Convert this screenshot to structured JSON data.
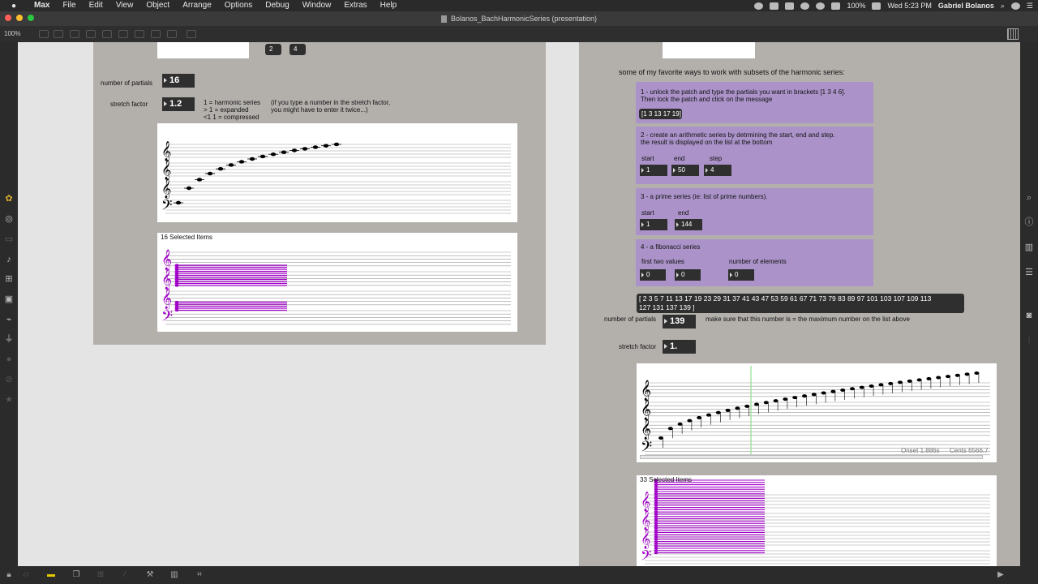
{
  "menubar": {
    "app": "Max",
    "items": [
      "File",
      "Edit",
      "View",
      "Object",
      "Arrange",
      "Options",
      "Debug",
      "Window",
      "Extras",
      "Help"
    ],
    "battery": "100%",
    "clock": "Wed 5:23 PM",
    "user": "Gabriel Bolanos"
  },
  "window": {
    "title": "Bolanos_BachHarmonicSeries (presentation)"
  },
  "toolbar": {
    "zoom": "100%"
  },
  "left_patch": {
    "small_boxes": [
      "2",
      "4"
    ],
    "partials_label": "number of partials",
    "partials_value": "16",
    "stretch_label": "stretch factor",
    "stretch_value": "1.2",
    "legend": [
      "1 = harmonic series",
      "> 1 = expanded",
      "<1 1 = compressed"
    ],
    "note": [
      "(if you type a number in the stretch factor,",
      "you might have to enter it twice...)"
    ],
    "selected_label": "16 Selected Items"
  },
  "right_patch": {
    "heading": "some of my favorite ways to work with subsets of the harmonic series:",
    "section1": {
      "text": [
        "1 - unlock the patch and type the partials you want in brackets [1 3 4 6].",
        "Then lock the patch and click on the message"
      ],
      "message": "[1 3 13 17 19]"
    },
    "section2": {
      "text": [
        "2 - create an arithmetic series by detrmining the start, end and step.",
        "the result is displayed on the list at the bottom"
      ],
      "labels": [
        "start",
        "end",
        "step"
      ],
      "values": [
        "1",
        "50",
        "4"
      ]
    },
    "section3": {
      "text": "3 - a prime series (ie: list of prime numbers).",
      "labels": [
        "start",
        "end"
      ],
      "values": [
        "1",
        "144"
      ]
    },
    "section4": {
      "text": "4 - a fibonacci series",
      "labels": [
        "first two values",
        "number of elements"
      ],
      "values": [
        "0",
        "0",
        "0"
      ]
    },
    "prime_list": [
      "[ 2 3 5 7 11 13 17 19 23 29 31 37 41 43 47 53 59 61 67 71 73 79 83 89 97 101 103 107 109 113",
      "127 131 137 139 ]"
    ],
    "partials_label": "number of partials",
    "partials_value": "139",
    "partials_note": "make sure that this number is = the maximum number on the list above",
    "stretch_label": "stretch factor",
    "stretch_value": "1.",
    "onset": "Onset 1.886s",
    "cents": "Cents 6566.7",
    "selected_label": "33 Selected Items"
  },
  "colors": {
    "panel_gray": "#b3b0ac",
    "purple_panel": "#ab93c9",
    "magenta_notes": "#a100c8",
    "cursor_line": "#8fe08f"
  },
  "icons": {
    "left_sidebar": [
      "objects-icon",
      "target-icon",
      "hidden-icon",
      "note-icon",
      "presentation-icon",
      "image-icon",
      "clip-icon",
      "plug-icon",
      "circle-icon",
      "disabled-icon",
      "star-icon"
    ],
    "right_sidebar": [
      "search-icon",
      "info-icon",
      "book-icon",
      "list-icon",
      "camera-icon",
      "sliders-icon"
    ],
    "bottom_bar": [
      "lock-icon",
      "edit-icon",
      "comment-icon",
      "windows-icon",
      "grid-icon",
      "wand-icon",
      "wrench-icon",
      "piano-icon",
      "keyboard-icon",
      "play-icon"
    ]
  }
}
